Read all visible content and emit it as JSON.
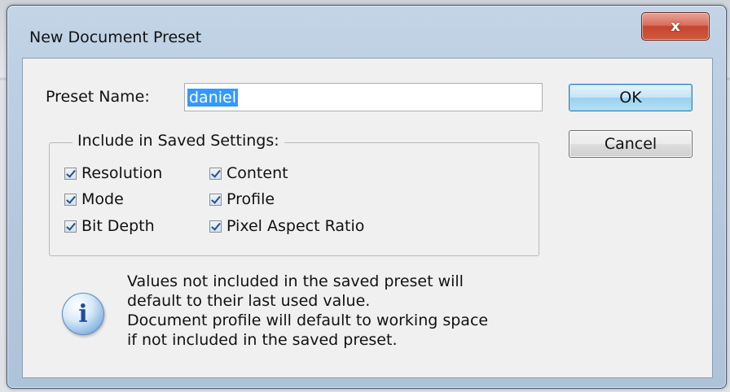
{
  "dialog": {
    "title": "New Document Preset",
    "close_label": "x"
  },
  "preset": {
    "label": "Preset Name:",
    "value": "daniel"
  },
  "buttons": {
    "ok": "OK",
    "cancel": "Cancel"
  },
  "settings_group": {
    "legend": "Include in Saved Settings:",
    "checkboxes": [
      {
        "label": "Resolution",
        "checked": true
      },
      {
        "label": "Content",
        "checked": true
      },
      {
        "label": "Mode",
        "checked": true
      },
      {
        "label": "Profile",
        "checked": true
      },
      {
        "label": "Bit Depth",
        "checked": true
      },
      {
        "label": "Pixel Aspect Ratio",
        "checked": true
      }
    ]
  },
  "info": {
    "icon": "info-icon",
    "lines": [
      "Values not included in the saved preset will",
      "default to their last used value.",
      "Document profile will default to working space",
      "if not included in the saved preset."
    ]
  }
}
